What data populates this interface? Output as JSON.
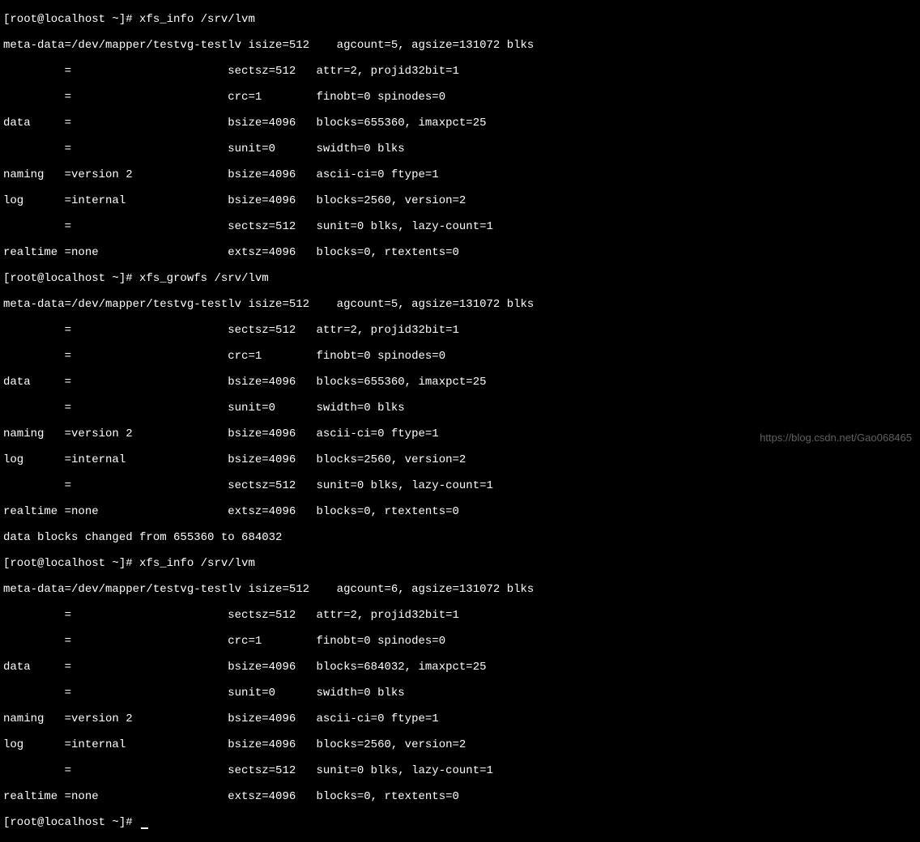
{
  "lines": {
    "l0": "[root@localhost ~]# xfs_info /srv/lvm",
    "l1": "meta-data=/dev/mapper/testvg-testlv isize=512    agcount=5, agsize=131072 blks",
    "l2": "         =                       sectsz=512   attr=2, projid32bit=1",
    "l3": "         =                       crc=1        finobt=0 spinodes=0",
    "l4": "data     =                       bsize=4096   blocks=655360, imaxpct=25",
    "l5": "         =                       sunit=0      swidth=0 blks",
    "l6": "naming   =version 2              bsize=4096   ascii-ci=0 ftype=1",
    "l7": "log      =internal               bsize=4096   blocks=2560, version=2",
    "l8": "         =                       sectsz=512   sunit=0 blks, lazy-count=1",
    "l9": "realtime =none                   extsz=4096   blocks=0, rtextents=0",
    "l10": "[root@localhost ~]# xfs_growfs /srv/lvm",
    "l11": "meta-data=/dev/mapper/testvg-testlv isize=512    agcount=5, agsize=131072 blks",
    "l12": "         =                       sectsz=512   attr=2, projid32bit=1",
    "l13": "         =                       crc=1        finobt=0 spinodes=0",
    "l14": "data     =                       bsize=4096   blocks=655360, imaxpct=25",
    "l15": "         =                       sunit=0      swidth=0 blks",
    "l16": "naming   =version 2              bsize=4096   ascii-ci=0 ftype=1",
    "l17": "log      =internal               bsize=4096   blocks=2560, version=2",
    "l18": "         =                       sectsz=512   sunit=0 blks, lazy-count=1",
    "l19": "realtime =none                   extsz=4096   blocks=0, rtextents=0",
    "l20": "data blocks changed from 655360 to 684032",
    "l21": "[root@localhost ~]# xfs_info /srv/lvm",
    "l22": "meta-data=/dev/mapper/testvg-testlv isize=512    agcount=6, agsize=131072 blks",
    "l23": "         =                       sectsz=512   attr=2, projid32bit=1",
    "l24": "         =                       crc=1        finobt=0 spinodes=0",
    "l25": "data     =                       bsize=4096   blocks=684032, imaxpct=25",
    "l26": "         =                       sunit=0      swidth=0 blks",
    "l27": "naming   =version 2              bsize=4096   ascii-ci=0 ftype=1",
    "l28": "log      =internal               bsize=4096   blocks=2560, version=2",
    "l29": "         =                       sectsz=512   sunit=0 blks, lazy-count=1",
    "l30": "realtime =none                   extsz=4096   blocks=0, rtextents=0",
    "l31": "[root@localhost ~]# "
  },
  "watermark": "https://blog.csdn.net/Gao068465"
}
